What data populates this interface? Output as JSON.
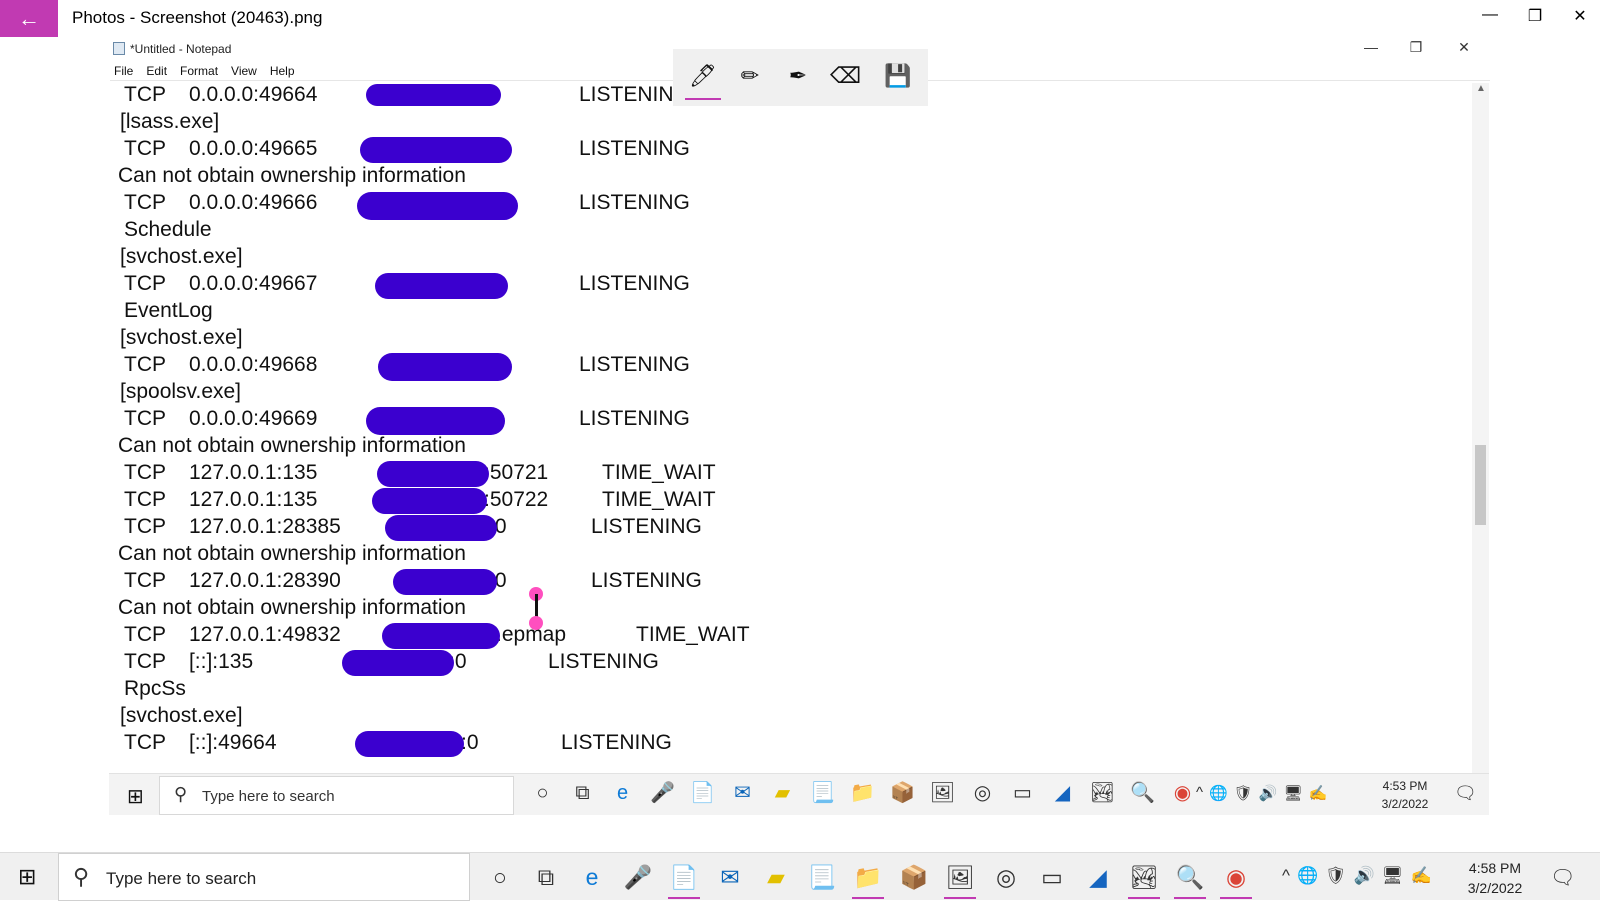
{
  "photos": {
    "title": "Photos - Screenshot (20463).png",
    "accent": "#c13ab2",
    "back_icon": "←",
    "minimize": "—",
    "restore": "❐",
    "close": "✕"
  },
  "notepad": {
    "title": "*Untitled - Notepad",
    "menu": [
      "File",
      "Edit",
      "Format",
      "View",
      "Help"
    ],
    "minimize": "—",
    "restore": "❐",
    "close": "✕"
  },
  "lines": [
    "TCP    0.0.0.0:49664",
    "[lsass.exe]",
    "TCP    0.0.0.0:49665",
    "Can not obtain ownership information",
    "TCP    0.0.0.0:49666",
    "Schedule",
    "[svchost.exe]",
    "TCP    0.0.0.0:49667",
    "EventLog",
    "[svchost.exe]",
    "TCP    0.0.0.0:49668",
    "[spoolsv.exe]",
    "TCP    0.0.0.0:49669",
    "Can not obtain ownership information",
    "TCP    127.0.0.1:135",
    "TCP    127.0.0.1:135",
    "TCP    127.0.0.1:28385",
    "Can not obtain ownership information",
    "TCP    127.0.0.1:28390",
    "Can not obtain ownership information",
    "TCP    127.0.0.1:49832",
    "TCP    [::]:135",
    "RpcSs",
    "[svchost.exe]",
    "TCP    [::]:49664"
  ],
  "foreign_tails": [
    ":50721",
    ":50722",
    ":0",
    ":0",
    ".epmap",
    ":0",
    ":0"
  ],
  "states": [
    "LISTENING",
    "LISTENING",
    "LISTENING",
    "LISTENING",
    "LISTENING",
    "LISTENING",
    "TIME_WAIT",
    "TIME_WAIT",
    "LISTENING",
    "LISTENING",
    "TIME_WAIT",
    "LISTENING",
    "LISTENING"
  ],
  "ink_tools": {
    "ballpoint": "🖊",
    "pencil": "✏",
    "calligraphy": "✒",
    "eraser": "⌫",
    "save": "💾"
  },
  "inner_taskbar": {
    "search_placeholder": "Type here to search",
    "time": "4:53 PM",
    "date": "3/2/2022"
  },
  "taskbar": {
    "search_placeholder": "Type here to search",
    "time": "4:58 PM",
    "date": "3/2/2022"
  },
  "icons": {
    "start": "⊞",
    "search": "⚲",
    "cortana": "○",
    "task_view": "⧉",
    "edge": "e",
    "mic": "🎤",
    "notepad": "📄",
    "mail": "✉",
    "sticky": "▰",
    "doc": "📃",
    "folder": "📁",
    "box": "📦",
    "image": "🖼",
    "circle": "◎",
    "terminal": "▭",
    "shark": "◢",
    "photos": "🏞",
    "magnifier": "🔍",
    "chrome": "◉",
    "chevron": "^",
    "globe": "🌐",
    "shield": "🛡",
    "speaker": "🔊",
    "display": "🖥",
    "pen": "✍",
    "notification": "🗨"
  }
}
